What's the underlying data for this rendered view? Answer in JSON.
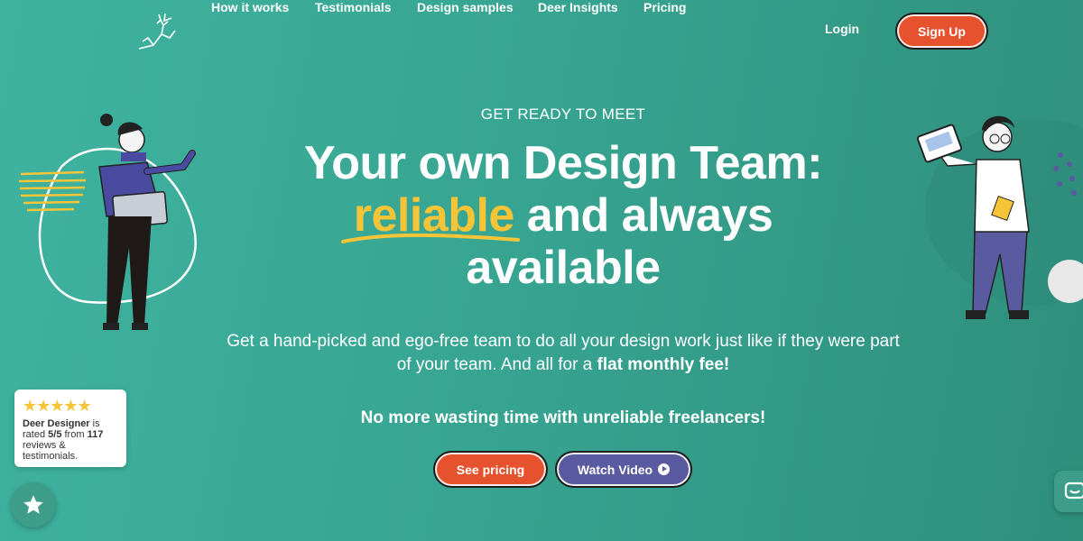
{
  "nav": {
    "items": [
      "How it works",
      "Testimonials",
      "Design samples",
      "Deer Insights",
      "Pricing"
    ],
    "login": "Login",
    "signup": "Sign Up"
  },
  "hero": {
    "eyebrow": "GET READY TO MEET",
    "line1": "Your own Design Team:",
    "highlight": "reliable",
    "line2_rest": " and always",
    "line3": "available",
    "sub_text": "Get a hand-picked and ego-free team to do all your design work just like if they were part of your team. And all for a ",
    "sub_bold": "flat monthly fee!",
    "tagline": "No more wasting time with unreliable freelancers!",
    "btn_pricing": "See pricing",
    "btn_video": "Watch Video"
  },
  "rating": {
    "stars": "★★★★★",
    "brand": "Deer Designer",
    "is": " is",
    "rated": "rated ",
    "score": "5/5",
    "from": " from ",
    "count": "117",
    "rest": "reviews & testimonials."
  },
  "colors": {
    "background": "#37a592",
    "accent_orange": "#e5522d",
    "accent_purple": "#5a5aa0",
    "highlight_yellow": "#f5c537"
  },
  "icons": [
    "deer-logo-icon",
    "star-icon",
    "play-icon",
    "chat-icon"
  ]
}
